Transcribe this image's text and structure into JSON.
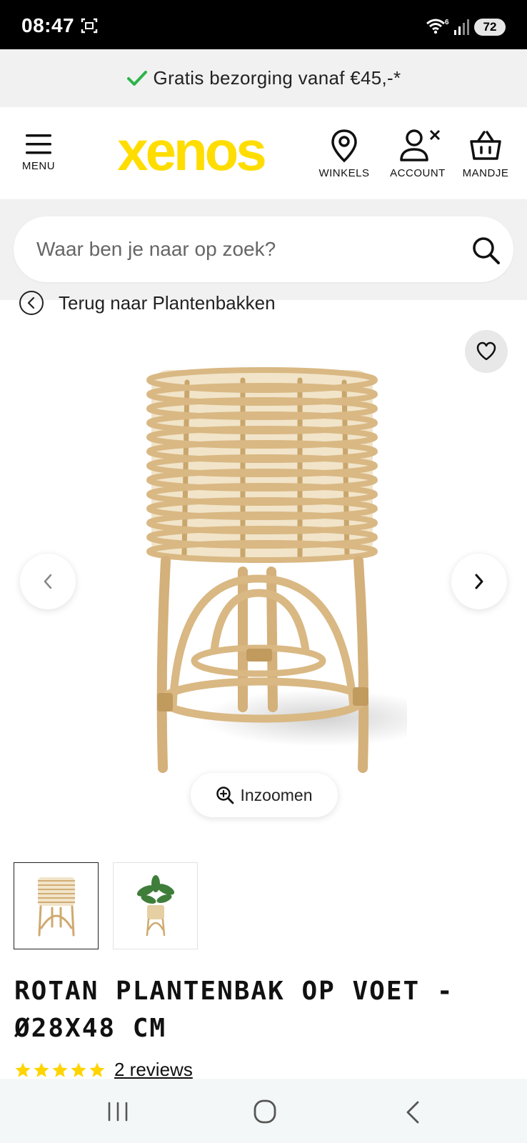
{
  "status_bar": {
    "time": "08:47",
    "battery": "72",
    "wifi_label": "6"
  },
  "promo": {
    "text": "Gratis bezorging vanaf €45,-*",
    "check_color": "#2db34a"
  },
  "header": {
    "menu_label": "MENU",
    "logo_text": "xenos",
    "logo_color": "#ffdd00",
    "stores_label": "WINKELS",
    "account_label": "ACCOUNT",
    "cart_label": "MANDJE"
  },
  "search": {
    "placeholder": "Waar ben je naar op zoek?"
  },
  "breadcrumb": {
    "back_label": "Terug naar Plantenbakken"
  },
  "gallery": {
    "zoom_label": "Inzoomen",
    "thumbnails": [
      "rattan-plant-stand",
      "rattan-plant-stand-with-plant"
    ],
    "selected_index": 0
  },
  "product": {
    "title": "ROTAN PLANTENBAK OP VOET - Ø28X48 CM",
    "rating": 5,
    "star_color": "#ffd400",
    "reviews_label": "2 reviews"
  },
  "icons": {
    "status_screenshot": "screenshot-icon",
    "wifi": "wifi-icon",
    "signal": "signal-icon",
    "menu": "hamburger-icon",
    "stores": "location-pin-icon",
    "account": "user-icon",
    "cart": "basket-icon",
    "search": "search-icon",
    "back": "chevron-left-circle-icon",
    "wishlist": "heart-icon",
    "prev": "chevron-left-icon",
    "next": "chevron-right-icon",
    "zoom": "zoom-in-icon"
  }
}
